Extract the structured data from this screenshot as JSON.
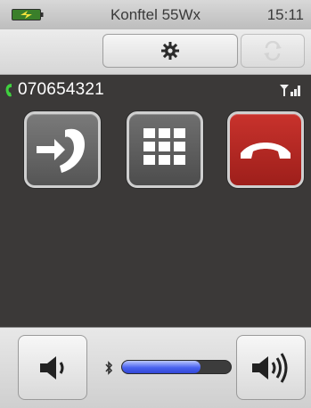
{
  "status": {
    "title": "Konftel 55Wx",
    "time": "15:11",
    "battery_icon": "battery-charging-icon"
  },
  "toolbar": {
    "settings_icon": "gear-icon",
    "rotate_icon": "rotate-icon"
  },
  "call": {
    "number": "070654321",
    "call_icon": "handset-icon",
    "signal_icon": "mobile-signal-icon"
  },
  "buttons": {
    "transfer_icon": "call-transfer-icon",
    "keypad_icon": "keypad-icon",
    "hangup_icon": "hang-up-icon"
  },
  "volume": {
    "level": 0.72,
    "down_icon": "volume-down-icon",
    "up_icon": "volume-up-icon",
    "bluetooth_icon": "bluetooth-icon"
  },
  "colors": {
    "hangup": "#b3261f",
    "accent_blue": "#4a63f0",
    "call_green": "#3fd13f"
  }
}
